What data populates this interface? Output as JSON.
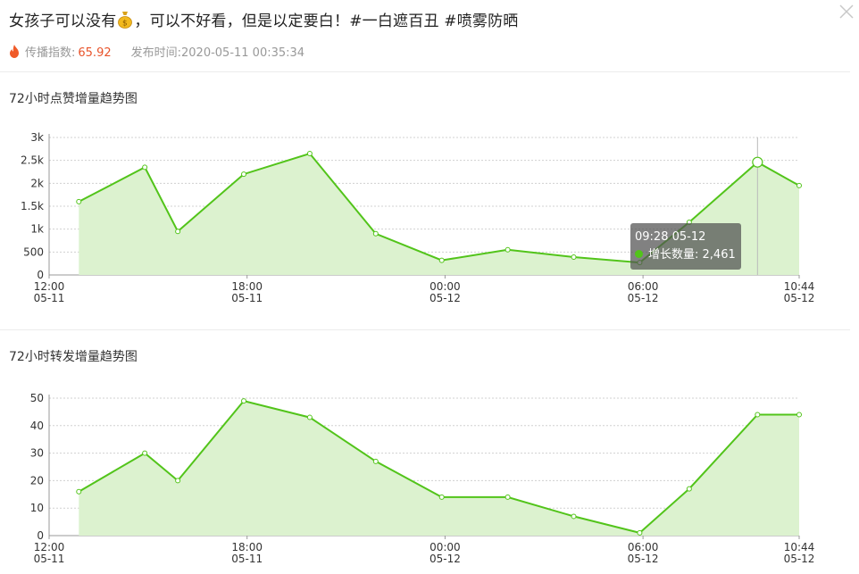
{
  "post": {
    "title_prefix": "女孩子可以没有",
    "title_suffix": "，可以不好看，但是以定要白！#一白遮百丑 #喷雾防晒",
    "spread_label": "传播指数:",
    "spread_value": "65.92",
    "publish_label": "发布时间:",
    "publish_time": "2020-05-11 00:35:34"
  },
  "icons": {
    "close": "close-icon",
    "fire": "fire-icon",
    "money": "money-bag-icon"
  },
  "colors": {
    "line": "#52c41a",
    "area": "#dcf2cf",
    "accent": "#e8542b"
  },
  "charts": [
    {
      "section_title": "72小时点赞增量趋势图",
      "chart_data": {
        "type": "area",
        "ylim": [
          0,
          3000
        ],
        "y_ticks": [
          0,
          500,
          1000,
          1500,
          2000,
          2500,
          3000
        ],
        "y_tick_labels": [
          "0",
          "500",
          "1k",
          "1.5k",
          "2k",
          "2.5k",
          "3k"
        ],
        "x_ticks": [
          {
            "t": 0,
            "time": "12:00",
            "date": "05-11"
          },
          {
            "t": 6,
            "time": "18:00",
            "date": "05-11"
          },
          {
            "t": 12,
            "time": "00:00",
            "date": "05-12"
          },
          {
            "t": 18,
            "time": "06:00",
            "date": "05-12"
          },
          {
            "t": 22.733,
            "time": "10:44",
            "date": "05-12"
          }
        ],
        "x_range": [
          0,
          22.733
        ],
        "points": [
          [
            0.9,
            1600
          ],
          [
            2.9,
            2350
          ],
          [
            3.9,
            950
          ],
          [
            5.9,
            2200
          ],
          [
            7.9,
            2650
          ],
          [
            9.9,
            900
          ],
          [
            11.9,
            320
          ],
          [
            13.9,
            550
          ],
          [
            15.9,
            390
          ],
          [
            17.9,
            270
          ],
          [
            19.4,
            1150
          ],
          [
            21.47,
            2461
          ],
          [
            22.733,
            1950
          ]
        ],
        "grid": true,
        "highlight_index": 11,
        "tooltip": {
          "title": "09:28 05-12",
          "label": "增长数量:",
          "value": "2,461"
        }
      }
    },
    {
      "section_title": "72小时转发增量趋势图",
      "chart_data": {
        "type": "area",
        "ylim": [
          0,
          50
        ],
        "y_ticks": [
          0,
          10,
          20,
          30,
          40,
          50
        ],
        "y_tick_labels": [
          "0",
          "10",
          "20",
          "30",
          "40",
          "50"
        ],
        "x_ticks": [
          {
            "t": 0,
            "time": "12:00",
            "date": "05-11"
          },
          {
            "t": 6,
            "time": "18:00",
            "date": "05-11"
          },
          {
            "t": 12,
            "time": "00:00",
            "date": "05-12"
          },
          {
            "t": 18,
            "time": "06:00",
            "date": "05-12"
          },
          {
            "t": 22.733,
            "time": "10:44",
            "date": "05-12"
          }
        ],
        "x_range": [
          0,
          22.733
        ],
        "points": [
          [
            0.9,
            16
          ],
          [
            2.9,
            30
          ],
          [
            3.9,
            20
          ],
          [
            5.9,
            49
          ],
          [
            7.9,
            43
          ],
          [
            9.9,
            27
          ],
          [
            11.9,
            14
          ],
          [
            13.9,
            14
          ],
          [
            15.9,
            7
          ],
          [
            17.9,
            1
          ],
          [
            19.4,
            17
          ],
          [
            21.47,
            44
          ],
          [
            22.733,
            44
          ]
        ],
        "grid": true
      }
    }
  ]
}
